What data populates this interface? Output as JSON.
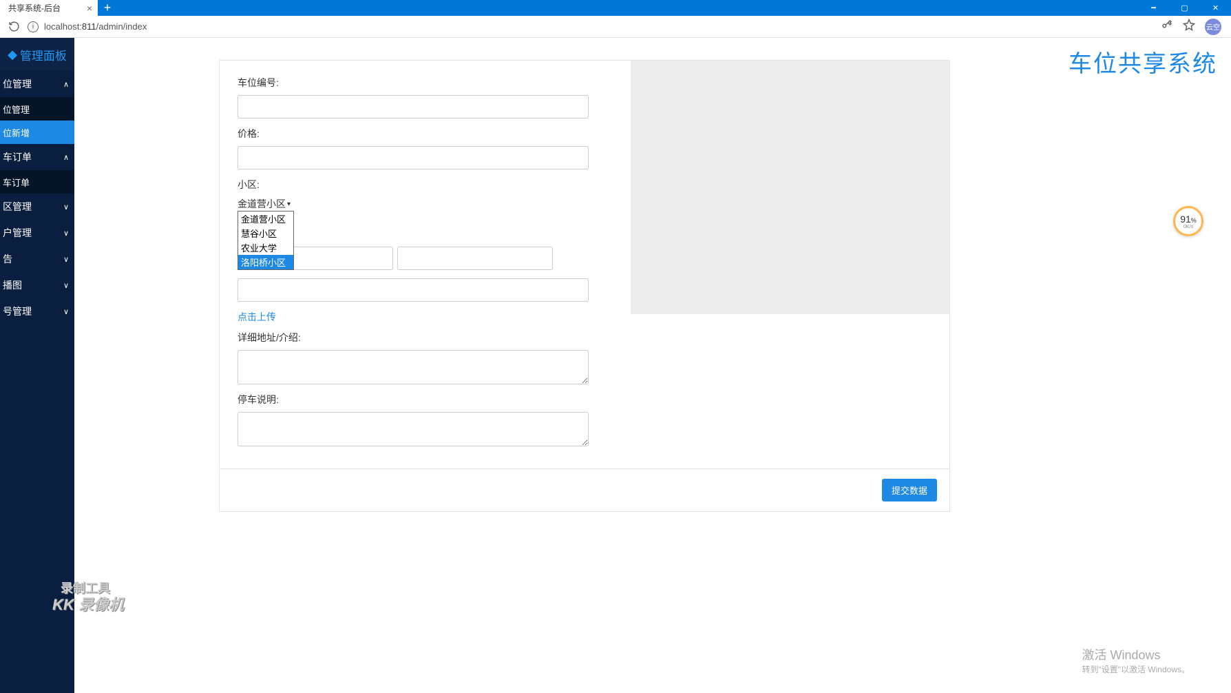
{
  "browser": {
    "tab_title": "共享系统-后台",
    "url_host": "localhost:",
    "url_port": "811",
    "url_path": "/admin/index",
    "avatar_text": "云空"
  },
  "sidebar": {
    "brand": "管理面板",
    "items": [
      {
        "label": "位管理",
        "expanded": true
      },
      {
        "label": "位管理",
        "sub": true
      },
      {
        "label": "位新增",
        "sub": true,
        "active": true
      },
      {
        "label": "车订单",
        "expanded": true
      },
      {
        "label": "车订单",
        "sub": true
      },
      {
        "label": "区管理",
        "expanded": false
      },
      {
        "label": "户管理",
        "expanded": false
      },
      {
        "label": "告",
        "expanded": false
      },
      {
        "label": "播图",
        "expanded": false
      },
      {
        "label": "号管理",
        "expanded": false
      }
    ]
  },
  "page_title": "车位共享系统",
  "form": {
    "labels": {
      "number": "车位编号:",
      "price": "价格:",
      "community": "小区:",
      "detail": "详细地址/介绍:",
      "note": "停车说明:"
    },
    "community_selected": "金道营小区",
    "community_options": [
      "金道营小区",
      "慧谷小区",
      "农业大学",
      "洛阳桥小区"
    ],
    "community_highlight_index": 3,
    "upload_text": "点击上传",
    "submit_text": "提交数据"
  },
  "speed": {
    "value": "91",
    "unit": "%",
    "sub": "0K/s"
  },
  "watermark": {
    "tool": "录制工具",
    "kk": "KK 录像机"
  },
  "activate": {
    "line1": "激活 Windows",
    "line2": "转到\"设置\"以激活 Windows。"
  }
}
